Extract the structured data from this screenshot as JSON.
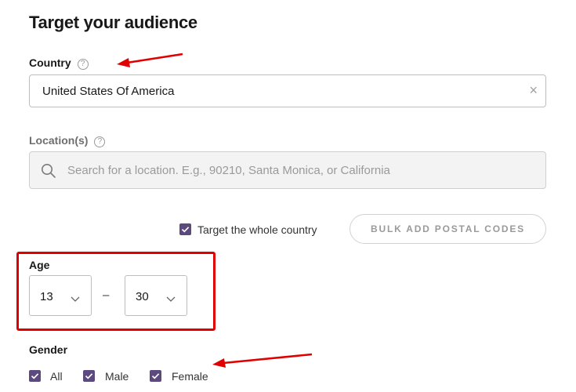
{
  "page": {
    "title": "Target your audience"
  },
  "country": {
    "label": "Country",
    "help_icon": "?",
    "value": "United States Of America",
    "clear_icon": "×"
  },
  "locations": {
    "label": "Location(s)",
    "help_icon": "?",
    "placeholder": "Search for a location. E.g., 90210, Santa Monica, or California"
  },
  "whole_country": {
    "label": "Target the whole country",
    "checked": true
  },
  "bulk_button": {
    "label": "BULK ADD POSTAL CODES"
  },
  "age": {
    "label": "Age",
    "min": "13",
    "separator": "–",
    "max": "30"
  },
  "gender": {
    "label": "Gender",
    "options": [
      {
        "label": "All",
        "checked": true
      },
      {
        "label": "Male",
        "checked": true
      },
      {
        "label": "Female",
        "checked": true
      }
    ]
  },
  "colors": {
    "checkbox": "#5c4a7f",
    "annotation": "#e00000"
  }
}
